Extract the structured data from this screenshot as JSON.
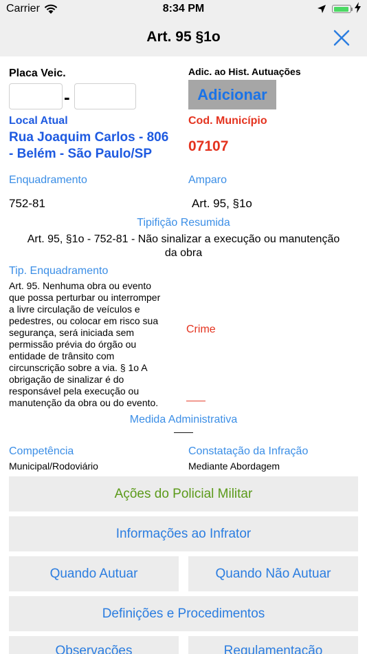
{
  "status_bar": {
    "carrier": "Carrier",
    "time": "8:34 PM"
  },
  "nav": {
    "title": "Art. 95 §1o"
  },
  "plate": {
    "label": "Placa Veic.",
    "separator": "-",
    "part1": "",
    "part2": ""
  },
  "history": {
    "label": "Adic. ao Hist. Autuações",
    "add_button": "Adicionar"
  },
  "location": {
    "label": "Local Atual",
    "line1": "Rua Joaquim Carlos - 806",
    "line2": "- Belém - São Paulo/SP"
  },
  "municipality": {
    "label": "Cod. Município",
    "code": "07107"
  },
  "enquadramento": {
    "label": "Enquadramento",
    "value": "752-81"
  },
  "amparo": {
    "label": "Amparo",
    "value": "Art. 95, §1o"
  },
  "tipificacao": {
    "label": "Tipifição Resumida",
    "line1": "Art. 95, §1o - 752-81 - Não sinalizar a execução ou manutenção",
    "line2": "da obra"
  },
  "tip_enquadramento": {
    "label": "Tip. Enquadramento",
    "lines": [
      "Art. 95. Nenhuma obra ou evento",
      "que possa perturbar ou interromper",
      "a livre circulação de veículos e",
      "pedestres, ou colocar em risco sua",
      "segurança, será iniciada sem",
      "permissão prévia do órgão ou",
      "entidade de trânsito com",
      "circunscrição sobre a via. § 1o A",
      "obrigação de sinalizar é do",
      "responsável pela execução ou",
      "manutenção da obra ou do evento."
    ]
  },
  "crime": {
    "label": "Crime",
    "value": "——"
  },
  "medida": {
    "label": "Medida Administrativa",
    "value": "——"
  },
  "competencia": {
    "label": "Competência",
    "value": "Municipal/Rodoviário"
  },
  "constatacao": {
    "label": "Constatação da Infração",
    "value": "Mediante Abordagem"
  },
  "buttons": {
    "acoes": "Ações do Policial Militar",
    "informacoes": "Informações ao Infrator",
    "quando_autuar": "Quando Autuar",
    "quando_nao_autuar": "Quando Não Autuar",
    "definicoes": "Definições e Procedimentos",
    "observacoes": "Observações",
    "regulamentacao": "Regulamentação"
  },
  "colors": {
    "accent_blue": "#2b7de0",
    "heading_blue": "#1e5ae0",
    "alert_red": "#e4331f",
    "action_green": "#5b9a1a",
    "battery_green": "#4cd964"
  },
  "icons": [
    "wifi-icon",
    "location-arrow-icon",
    "battery-icon",
    "charging-bolt-icon",
    "close-icon"
  ]
}
